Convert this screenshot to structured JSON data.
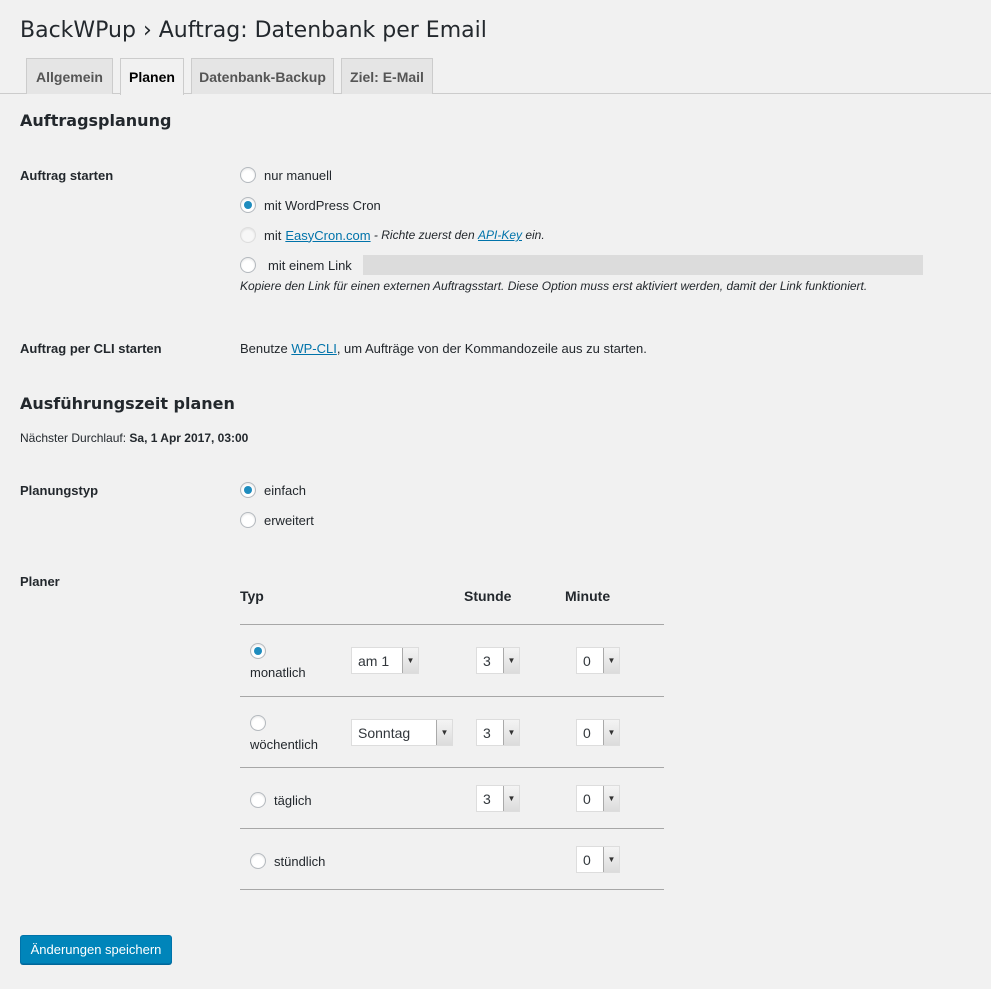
{
  "page": {
    "title": "BackWPup › Auftrag: Datenbank per Email"
  },
  "tabs": [
    {
      "label": "Allgemein",
      "active": false
    },
    {
      "label": "Planen",
      "active": true
    },
    {
      "label": "Datenbank-Backup",
      "active": false
    },
    {
      "label": "Ziel: E-Mail",
      "active": false
    }
  ],
  "planning": {
    "heading": "Auftragsplanung",
    "start_label": "Auftrag starten",
    "options": {
      "manual": "nur manuell",
      "wpcron": "mit WordPress Cron",
      "easycron_prefix": "mit",
      "easycron_link": "EasyCron.com",
      "easycron_note_pre": " - Richte zuerst den ",
      "easycron_apikey": "API-Key",
      "easycron_note_post": " ein.",
      "link": "mit einem Link"
    },
    "selected": "wpcron",
    "link_value": "",
    "link_hint": "Kopiere den Link für einen externen Auftragsstart. Diese Option muss erst aktiviert werden, damit der Link funktioniert.",
    "cli_label": "Auftrag per CLI starten",
    "cli_pre": "Benutze ",
    "cli_link": "WP-CLI",
    "cli_post": ", um Aufträge von der Kommandozeile aus zu starten."
  },
  "execution": {
    "heading": "Ausführungszeit planen",
    "next_run_label": "Nächster Durchlauf:",
    "next_run_value": "Sa, 1 Apr 2017, 03:00",
    "type_label": "Planungstyp",
    "type_simple": "einfach",
    "type_advanced": "erweitert",
    "type_selected": "einfach"
  },
  "scheduler": {
    "label": "Planer",
    "headers": {
      "type": "Typ",
      "hour": "Stunde",
      "minute": "Minute"
    },
    "rows": [
      {
        "label": "monatlich",
        "checked": true,
        "day_select": "am 1",
        "hour": "3",
        "minute": "0"
      },
      {
        "label": "wöchentlich",
        "checked": false,
        "day_select": "Sonntag",
        "hour": "3",
        "minute": "0"
      },
      {
        "label": "täglich",
        "checked": false,
        "hour": "3",
        "minute": "0"
      },
      {
        "label": "stündlich",
        "checked": false,
        "minute": "0"
      }
    ]
  },
  "actions": {
    "save_label": "Änderungen speichern"
  },
  "colors": {
    "accent": "#0085ba",
    "link": "#0073aa",
    "background": "#f1f1f1"
  }
}
